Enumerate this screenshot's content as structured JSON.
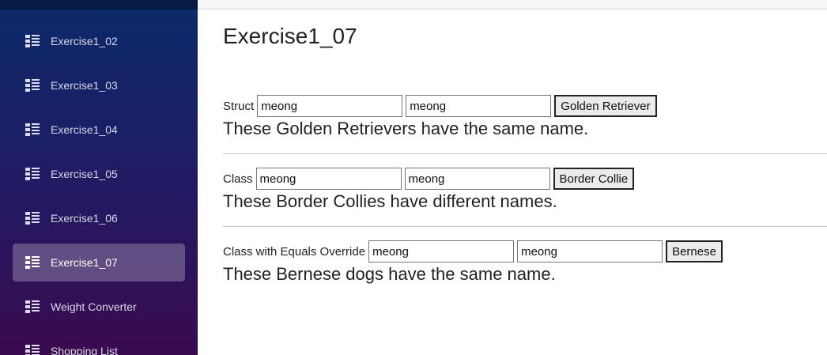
{
  "sidebar": {
    "items": [
      {
        "label": "Exercise1_02",
        "active": false
      },
      {
        "label": "Exercise1_03",
        "active": false
      },
      {
        "label": "Exercise1_04",
        "active": false
      },
      {
        "label": "Exercise1_05",
        "active": false
      },
      {
        "label": "Exercise1_06",
        "active": false
      },
      {
        "label": "Exercise1_07",
        "active": true
      },
      {
        "label": "Weight Converter",
        "active": false
      },
      {
        "label": "Shopping List",
        "active": false
      }
    ]
  },
  "page": {
    "title": "Exercise1_07"
  },
  "sections": [
    {
      "label": "Struct",
      "input1": "meong",
      "input2": "meong",
      "button": "Golden Retriever",
      "result": "These Golden Retrievers have the same name."
    },
    {
      "label": "Class",
      "input1": "meong",
      "input2": "meong",
      "button": "Border Collie",
      "result": "These Border Collies have different names."
    },
    {
      "label": "Class with Equals Override",
      "input1": "meong",
      "input2": "meong",
      "button": "Bernese",
      "result": "These Bernese dogs have the same name."
    }
  ],
  "colors": {
    "sidebar_top": "#0a2a68",
    "sidebar_bottom": "#3a0a4f",
    "active_item": "rgba(255,255,255,0.25)"
  },
  "icons": {
    "nav": "list-detail-icon"
  }
}
